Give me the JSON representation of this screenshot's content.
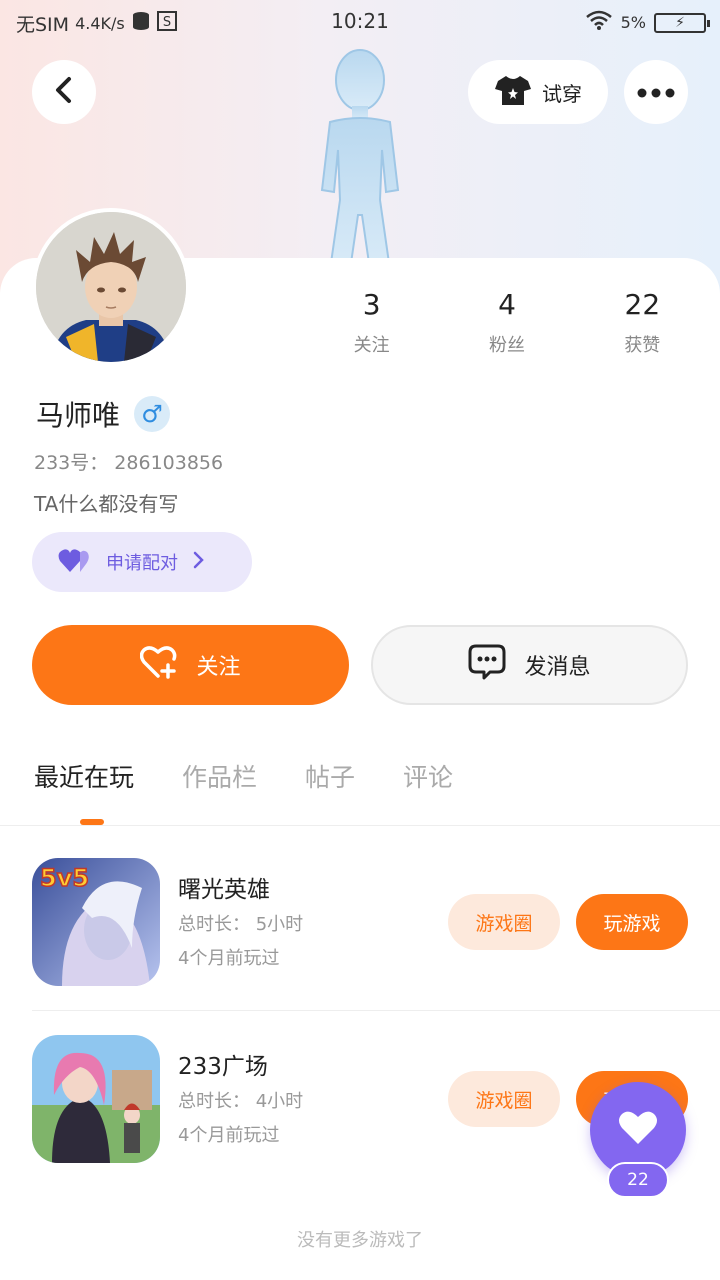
{
  "status_bar": {
    "carrier": "无SIM",
    "speed": "4.4K/s",
    "time": "10:21",
    "battery_pct": "5%"
  },
  "header": {
    "tryon_label": "试穿"
  },
  "profile": {
    "name": "马师唯",
    "gender_symbol": "♂",
    "uid": "233号： 286103856",
    "bio": "TA什么都没有写",
    "pair_label": "申请配对"
  },
  "stats": [
    {
      "value": "3",
      "label": "关注"
    },
    {
      "value": "4",
      "label": "粉丝"
    },
    {
      "value": "22",
      "label": "获赞"
    }
  ],
  "actions": {
    "follow_label": "关注",
    "message_label": "发消息"
  },
  "tabs": [
    {
      "label": "最近在玩",
      "active": true
    },
    {
      "label": "作品栏",
      "active": false
    },
    {
      "label": "帖子",
      "active": false
    },
    {
      "label": "评论",
      "active": false
    }
  ],
  "games": [
    {
      "title": "曙光英雄",
      "duration": "总时长： 5小时",
      "last_played": "4个月前玩过",
      "circle_label": "游戏圈",
      "play_label": "玩游戏",
      "icon_badge": "5v5"
    },
    {
      "title": "233广场",
      "duration": "总时长： 4小时",
      "last_played": "4个月前玩过",
      "circle_label": "游戏圈",
      "play_label": "玩游戏"
    }
  ],
  "like_count": "22",
  "footer_note": "没有更多游戏了",
  "colors": {
    "accent": "#fd7616",
    "purple": "#8367f0"
  }
}
